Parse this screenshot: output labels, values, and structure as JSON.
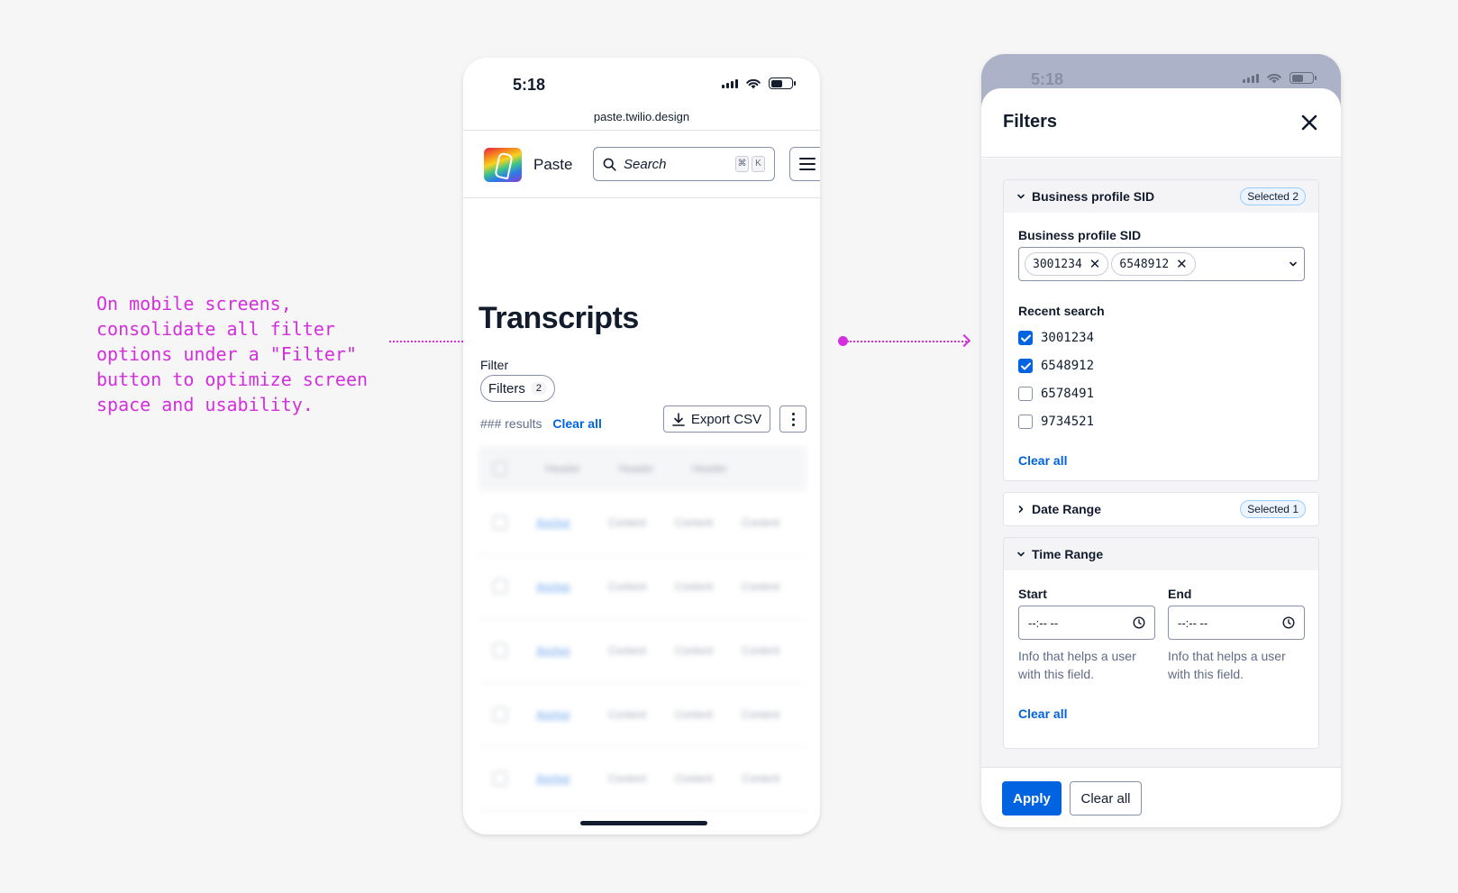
{
  "annotation": {
    "text": "On mobile screens, consolidate all filter options under a \"Filter\" button to optimize screen space and usability."
  },
  "phone_list": {
    "time": "5:18",
    "url": "paste.twilio.design",
    "brand": "Paste",
    "search_placeholder": "Search",
    "search_shortcut": [
      "⌘",
      "K"
    ],
    "page_title": "Transcripts",
    "filter_label": "Filter",
    "filters_button": "Filters",
    "filters_count": "2",
    "results_text": "### results",
    "clear_all": "Clear all",
    "export_button": "Export CSV",
    "table": {
      "headers": [
        "Header",
        "Header",
        "Header"
      ],
      "rows": [
        [
          "Anchor",
          "Content",
          "Content",
          "Content"
        ],
        [
          "Anchor",
          "Content",
          "Content",
          "Content"
        ],
        [
          "Anchor",
          "Content",
          "Content",
          "Content"
        ],
        [
          "Anchor",
          "Content",
          "Content",
          "Content"
        ],
        [
          "Anchor",
          "Content",
          "Content",
          "Content"
        ]
      ]
    }
  },
  "phone_filters": {
    "time": "5:18",
    "title": "Filters",
    "sections": {
      "business": {
        "title": "Business profile SID",
        "badge": "Selected 2",
        "field_label": "Business profile SID",
        "chips": [
          "3001234",
          "6548912"
        ],
        "recent_label": "Recent search",
        "options": [
          {
            "label": "3001234",
            "checked": true
          },
          {
            "label": "6548912",
            "checked": true
          },
          {
            "label": "6578491",
            "checked": false
          },
          {
            "label": "9734521",
            "checked": false
          }
        ],
        "clear_all": "Clear all"
      },
      "date": {
        "title": "Date Range",
        "badge": "Selected 1"
      },
      "time": {
        "title": "Time Range",
        "start_label": "Start",
        "end_label": "End",
        "start_value": "--:-- --",
        "end_value": "--:-- --",
        "help_start": "Info that helps a user with this field.",
        "help_end": "Info that helps a user with this field.",
        "clear_all": "Clear all"
      }
    },
    "apply_button": "Apply",
    "clear_all_button": "Clear all"
  },
  "colors": {
    "accent": "#0263e0",
    "annotation": "#d32fdc",
    "text": "#121c2d",
    "muted": "#606b85"
  }
}
